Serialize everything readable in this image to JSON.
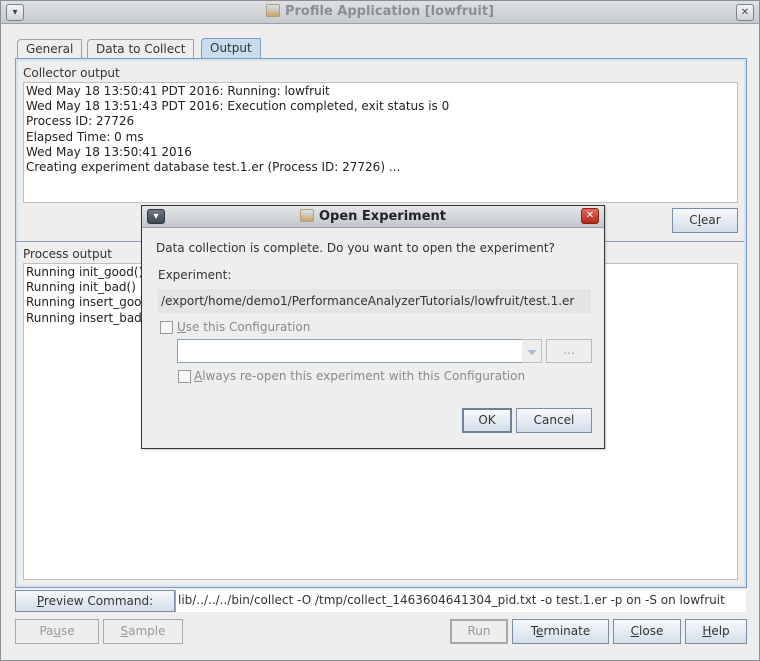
{
  "window": {
    "title": "Profile Application [lowfruit]",
    "menu_icon": "▾",
    "close_icon": "✕"
  },
  "tabs": [
    {
      "label": "General",
      "active": false
    },
    {
      "label": "Data to Collect",
      "active": false
    },
    {
      "label": "Output",
      "active": true
    }
  ],
  "collector": {
    "label": "Collector output",
    "lines": "Wed May 18 13:50:41 PDT 2016: Running: lowfruit\nWed May 18 13:51:43 PDT 2016: Execution completed, exit status is 0\nProcess ID: 27726\nElapsed Time: 0 ms\nWed May 18 13:50:41 2016\nCreating experiment database test.1.er (Process ID: 27726) ...",
    "clear_prefix": "C",
    "clear_mnemonic": "l",
    "clear_suffix": "ear"
  },
  "process": {
    "label": "Process output",
    "lines": "Running init_good()\nRunning init_bad()\nRunning insert_good()\nRunning insert_bad()"
  },
  "preview": {
    "button_mnemonic": "P",
    "button_rest": "review Command:",
    "command": "lib/../../../bin/collect -O /tmp/collect_1463604641304_pid.txt -o test.1.er -p on -S on lowfruit"
  },
  "buttons": {
    "pause": {
      "pre": "Pa",
      "mn": "u",
      "post": "se",
      "enabled": false
    },
    "sample": {
      "pre": "",
      "mn": "S",
      "post": "ample",
      "enabled": false
    },
    "run": {
      "label": "Run",
      "enabled": false
    },
    "terminate": {
      "pre": "T",
      "mn": "e",
      "post": "rminate",
      "enabled": true
    },
    "close": {
      "pre": "",
      "mn": "C",
      "post": "lose",
      "enabled": true
    },
    "help": {
      "pre": "",
      "mn": "H",
      "post": "elp",
      "enabled": true
    }
  },
  "dialog": {
    "title": "Open Experiment",
    "message": "Data collection is complete. Do you want to open the experiment?",
    "experiment_label": "Experiment:",
    "experiment_path": "/export/home/demo1/PerformanceAnalyzerTutorials/lowfruit/test.1.er",
    "use_config": {
      "mn": "U",
      "rest": "se this Configuration",
      "checked": false,
      "enabled": false
    },
    "config_value": "",
    "ellipsis_label": "...",
    "always_reopen": {
      "mn": "A",
      "rest": "lways re-open this experiment with this Configuration",
      "checked": false,
      "enabled": false
    },
    "ok_label": "OK",
    "cancel_label": "Cancel",
    "menu_icon": "▾",
    "close_icon": "✕"
  }
}
